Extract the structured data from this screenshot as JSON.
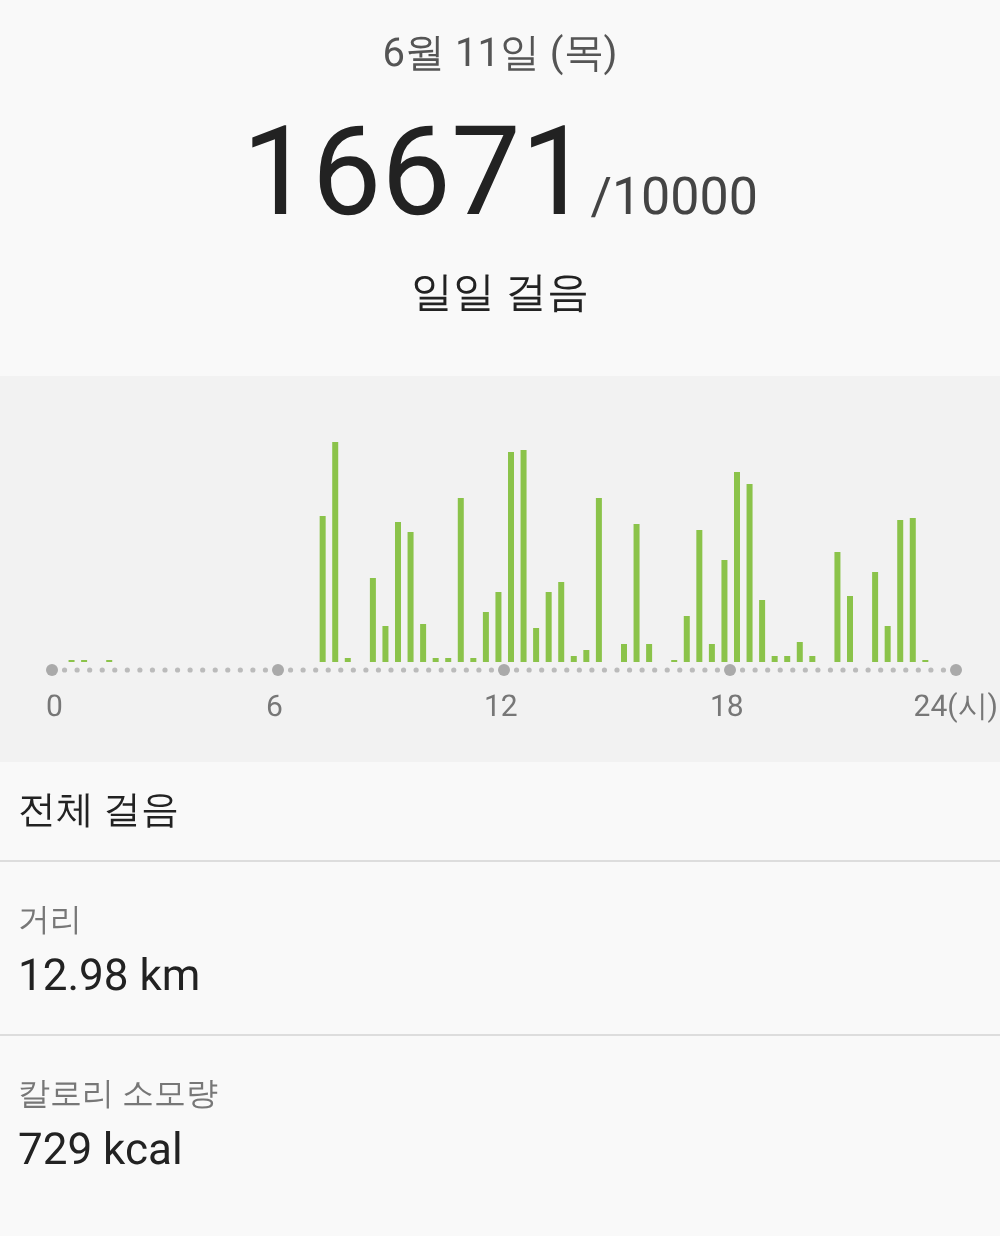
{
  "date": "6월 11일 (목)",
  "steps": {
    "count": "16671",
    "goal": "/10000",
    "label": "일일 걸음"
  },
  "chart": {
    "x_labels": [
      "0",
      "6",
      "12",
      "18",
      "24(시)"
    ]
  },
  "section_title": "전체 걸음",
  "stats": [
    {
      "label": "거리",
      "value": "12.98 km"
    },
    {
      "label": "칼로리 소모량",
      "value": "729 kcal"
    }
  ]
}
